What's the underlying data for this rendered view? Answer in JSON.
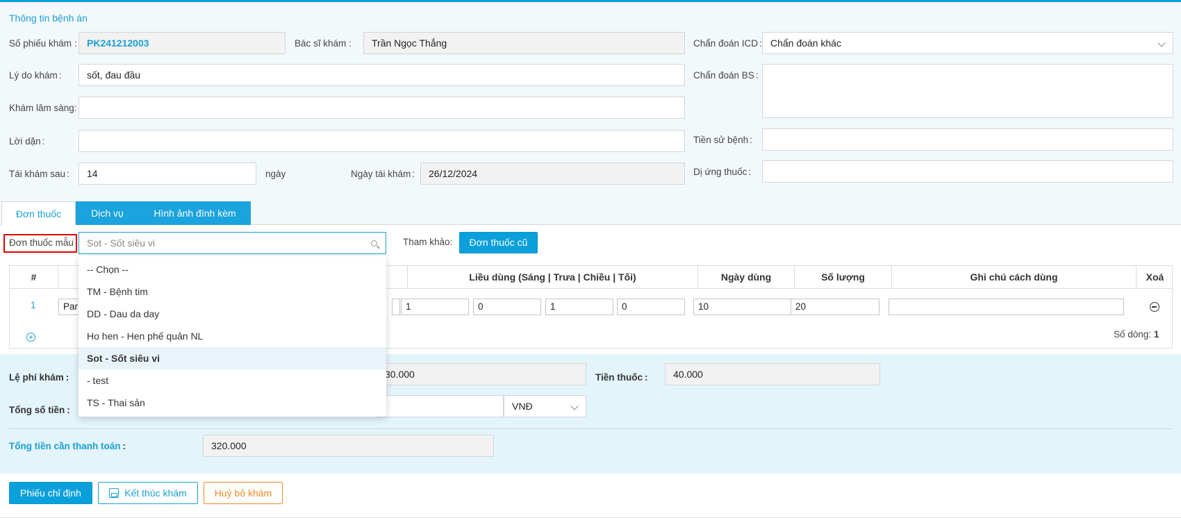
{
  "info": {
    "title": "Thông tin bệnh án",
    "so_phieu_label": "Số phiếu khám",
    "so_phieu_value": "PK241212003",
    "bac_si_label": "Bác sĩ khám",
    "bac_si_value": "Trần Ngọc Thắng",
    "icd_label": "Chẩn đoán ICD",
    "icd_value": "Chẩn đoán khác",
    "ly_do_label": "Lý do khám",
    "ly_do_value": "sốt, đau đầu",
    "chan_doan_bs_label": "Chẩn đoán BS",
    "chan_doan_bs_value": "",
    "kham_ls_label": "Khám lâm sàng",
    "kham_ls_value": "",
    "loi_dan_label": "Lời dặn",
    "loi_dan_value": "",
    "tien_su_label": "Tiền sử bệnh",
    "tien_su_value": "",
    "tai_kham_label": "Tái khám sau",
    "tai_kham_value": "14",
    "ngay_unit": "ngày",
    "ngay_tai_kham_label": "Ngày tái khám",
    "ngay_tai_kham_value": "26/12/2024",
    "di_ung_label": "Dị ứng thuốc",
    "di_ung_value": "",
    "colon": ":"
  },
  "tabs": [
    {
      "label": "Đơn thuốc",
      "active": true
    },
    {
      "label": "Dịch vụ",
      "active": false
    },
    {
      "label": "Hình ảnh đính kèm",
      "active": false
    }
  ],
  "prescription": {
    "template_label": "Đơn thuốc mẫu",
    "template_value": "Sot - Sốt siêu vi",
    "ref_label": "Tham khảo:",
    "old_button": "Đơn thuốc cũ",
    "headers": {
      "num": "#",
      "dosage": "Liều dùng (Sáng | Trưa | Chiều | Tối)",
      "days": "Ngày dùng",
      "qty": "Số lượng",
      "note": "Ghi chú cách dùng",
      "delete": "Xoá"
    },
    "rows": [
      {
        "index": "1",
        "drug": "Par",
        "sang": "1",
        "trua": "0",
        "chieu": "1",
        "toi": "0",
        "days": "10",
        "qty": "20",
        "note": ""
      }
    ],
    "row_count_label": "Số dòng:",
    "row_count": "1"
  },
  "dropdown": {
    "items": [
      {
        "label": "-- Chọn --",
        "selected": false
      },
      {
        "label": "TM - Bệnh tim",
        "selected": false
      },
      {
        "label": "DD - Dau da day",
        "selected": false
      },
      {
        "label": "Ho hen - Hen phế quản NL",
        "selected": false
      },
      {
        "label": "Sot - Sốt siêu vi",
        "selected": true
      },
      {
        "label": "- test",
        "selected": false
      },
      {
        "label": "TS - Thai sản",
        "selected": false
      }
    ]
  },
  "fees": {
    "le_phi_label": "Lệ phí khám",
    "le_phi_value": "30.000",
    "tien_thuoc_label": "Tiền thuốc",
    "tien_thuoc_value": "40.000",
    "tong_label": "Tổng số tiền",
    "currency": "VNĐ",
    "can_thanh_toan_label": "Tổng tiền cần thanh toán",
    "can_thanh_toan_value": "320.000"
  },
  "actions": {
    "phieu_chi_dinh": "Phiếu chỉ định",
    "ket_thuc": "Kết thúc khám",
    "huy_bo": "Huỷ bỏ khám"
  },
  "colors": {
    "accent": "#0aa0dc",
    "highlight_border": "#e00000",
    "cancel": "#f08a24"
  }
}
